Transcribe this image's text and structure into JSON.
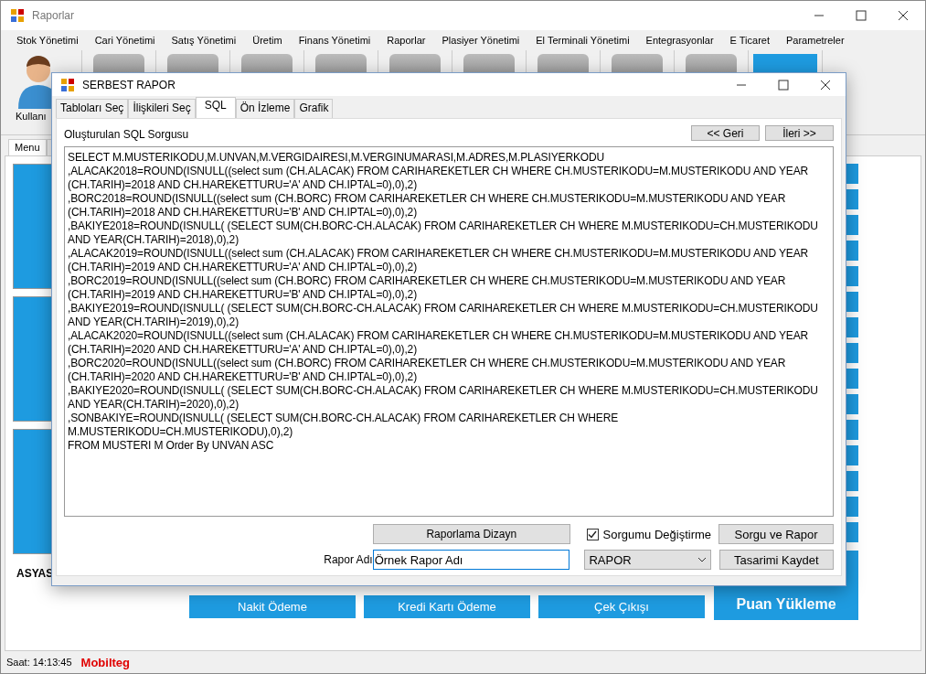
{
  "window": {
    "title": "Raporlar"
  },
  "menu": [
    "Stok Yönetimi",
    "Cari Yönetimi",
    "Satış Yönetimi",
    "Üretim",
    "Finans Yönetimi",
    "Raporlar",
    "Plasiyer Yönetimi",
    "El Terminali Yönetimi",
    "Entegrasyonlar",
    "E Ticaret",
    "Parametreler"
  ],
  "toolbar": {
    "user_label": "Kullanı"
  },
  "main_tabs": [
    {
      "label": "Menu",
      "selected": true
    }
  ],
  "left_label": "ASYAS",
  "bottom_buttons": [
    "Nakit Ödeme",
    "Kredi Kartı Ödeme",
    "Çek Çıkışı"
  ],
  "side_tile": "Puan Yükleme",
  "status_bar": {
    "time": "Saat: 14:13:45",
    "brand": "Mobilteg"
  },
  "dialog": {
    "title": "SERBEST RAPOR",
    "tabs": [
      {
        "label": "Tabloları Seç",
        "selected": false
      },
      {
        "label": "İlişkileri Seç",
        "selected": false
      },
      {
        "label": "SQL",
        "selected": true
      },
      {
        "label": "Ön İzleme",
        "selected": false
      },
      {
        "label": "Grafik",
        "selected": false
      }
    ],
    "sql_label": "Oluşturulan SQL Sorgusu",
    "back_button": "<< Geri",
    "next_button": "İleri >>",
    "sql_lines": [
      "SELECT M.MUSTERIKODU,M.UNVAN,M.VERGIDAIRESI,M.VERGINUMARASI,M.ADRES,M.PLASIYERKODU",
      ",ALACAK2018=ROUND(ISNULL((select sum (CH.ALACAK) FROM CARIHAREKETLER CH WHERE CH.MUSTERIKODU=M.MUSTERIKODU AND YEAR (CH.TARIH)=2018 AND CH.HAREKETTURU='A' AND CH.IPTAL=0),0),2)",
      ",BORC2018=ROUND(ISNULL((select sum (CH.BORC) FROM CARIHAREKETLER CH WHERE CH.MUSTERIKODU=M.MUSTERIKODU AND YEAR (CH.TARIH)=2018 AND CH.HAREKETTURU='B' AND CH.IPTAL=0),0),2)",
      ",BAKIYE2018=ROUND(ISNULL( (SELECT SUM(CH.BORC-CH.ALACAK) FROM CARIHAREKETLER CH WHERE M.MUSTERIKODU=CH.MUSTERIKODU AND YEAR(CH.TARIH)=2018),0),2)",
      ",ALACAK2019=ROUND(ISNULL((select sum (CH.ALACAK) FROM CARIHAREKETLER CH WHERE CH.MUSTERIKODU=M.MUSTERIKODU AND YEAR (CH.TARIH)=2019 AND CH.HAREKETTURU='A' AND CH.IPTAL=0),0),2)",
      ",BORC2019=ROUND(ISNULL((select sum (CH.BORC) FROM CARIHAREKETLER CH WHERE CH.MUSTERIKODU=M.MUSTERIKODU AND YEAR (CH.TARIH)=2019 AND CH.HAREKETTURU='B' AND CH.IPTAL=0),0),2)",
      ",BAKIYE2019=ROUND(ISNULL( (SELECT SUM(CH.BORC-CH.ALACAK) FROM CARIHAREKETLER CH WHERE M.MUSTERIKODU=CH.MUSTERIKODU AND YEAR(CH.TARIH)=2019),0),2)",
      ",ALACAK2020=ROUND(ISNULL((select sum (CH.ALACAK) FROM CARIHAREKETLER CH WHERE CH.MUSTERIKODU=M.MUSTERIKODU AND YEAR (CH.TARIH)=2020 AND CH.HAREKETTURU='A' AND CH.IPTAL=0),0),2)",
      ",BORC2020=ROUND(ISNULL((select sum (CH.BORC) FROM CARIHAREKETLER CH WHERE CH.MUSTERIKODU=M.MUSTERIKODU AND YEAR (CH.TARIH)=2020 AND CH.HAREKETTURU='B' AND CH.IPTAL=0),0),2)",
      ",BAKIYE2020=ROUND(ISNULL( (SELECT SUM(CH.BORC-CH.ALACAK) FROM CARIHAREKETLER CH WHERE M.MUSTERIKODU=CH.MUSTERIKODU AND YEAR(CH.TARIH)=2020),0),2)",
      ",SONBAKIYE=ROUND(ISNULL( (SELECT SUM(CH.BORC-CH.ALACAK) FROM CARIHAREKETLER CH WHERE M.MUSTERIKODU=CH.MUSTERIKODU),0),2)",
      "FROM MUSTERI M Order By UNVAN ASC"
    ],
    "design_button": "Raporlama Dizayn",
    "checkbox": {
      "label": "Sorgumu Değiştirme",
      "checked": true
    },
    "query_report_button": "Sorgu ve Rapor",
    "name_label": "Rapor Adı",
    "name_value": "Örnek Rapor Adı",
    "type_select": "RAPOR",
    "save_button": "Tasarimi Kaydet"
  }
}
